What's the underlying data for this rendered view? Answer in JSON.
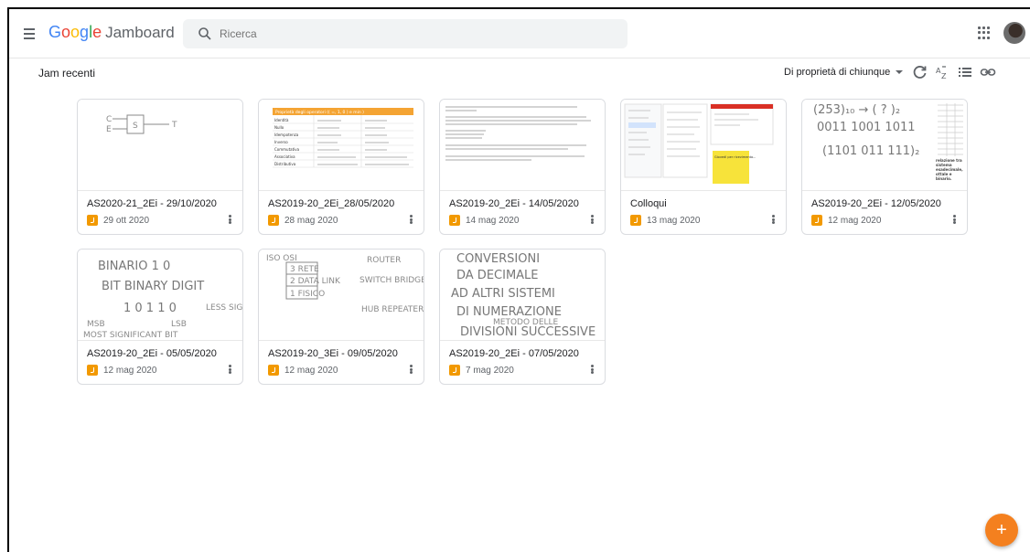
{
  "app": {
    "logo_google": "Google",
    "logo_product": "Jamboard",
    "search_placeholder": "Ricerca"
  },
  "icons": {
    "menu": "menu-icon",
    "search": "search-icon",
    "apps": "apps-grid-icon",
    "refresh": "refresh-icon",
    "sort": "sort-az-icon",
    "list": "list-view-icon",
    "link": "link-icon",
    "add": "add-icon"
  },
  "toolbar": {
    "section_title": "Jam recenti",
    "owner_filter": "Di proprietà di chiunque"
  },
  "colors": {
    "fab": "#f4801f",
    "jam_icon": "#f29900",
    "table_header": "#f4a433",
    "sticky_note": "#f7e33a"
  },
  "jams": [
    {
      "title": "AS2020-21_2Ei - 29/10/2020",
      "date": "29 ott 2020"
    },
    {
      "title": "AS2019-20_2Ei_28/05/2020",
      "date": "28 mag 2020"
    },
    {
      "title": "AS2019-20_2Ei - 14/05/2020",
      "date": "14 mag 2020"
    },
    {
      "title": "Colloqui",
      "date": "13 mag 2020"
    },
    {
      "title": "AS2019-20_2Ei - 12/05/2020",
      "date": "12 mag 2020"
    },
    {
      "title": "AS2019-20_2Ei - 05/05/2020",
      "date": "12 mag 2020"
    },
    {
      "title": "AS2019-20_3Ei - 09/05/2020",
      "date": "12 mag 2020"
    },
    {
      "title": "AS2019-20_2Ei - 07/05/2020",
      "date": "7 mag 2020"
    }
  ],
  "thumbs": {
    "t1": {
      "c": "C",
      "e": "E",
      "s": "S",
      "t": "T"
    },
    "t2": {
      "header": "Proprietà degli operatori (( =, 1, 0 ) e min )",
      "rows": [
        "Identità",
        "Nullo",
        "Idempotenza",
        "Inverso",
        "Commutativa",
        "Associativa",
        "Distributiva"
      ]
    },
    "t4": {
      "note": "Giovedì per ricevimento..."
    },
    "t5": {
      "line1": "(253)₁₀ → ( ? )₂",
      "line2": "0011 1001 1011",
      "line3": "(1101 011 111)₂",
      "side": "relazione tra sistema esadecimale, ottale e binario."
    },
    "t6": {
      "l1": "BINARIO 1 0",
      "l2": "BIT BINARY DIGIT",
      "l3": "1 0 1 1 0",
      "l4": "MSB",
      "l5": "LSB",
      "l6": "LESS SIGN BIT",
      "l7": "MOST SIGNIFICANT BIT"
    },
    "t7": {
      "l1": "ISO OSI",
      "l2": "3 RETE",
      "l3": "2 DATA LINK",
      "l4": "1 FISICO",
      "l5": "ROUTER",
      "l6": "SWITCH BRIDGE",
      "l7": "HUB REPEATER"
    },
    "t8": {
      "l1": "CONVERSIONI",
      "l2": "DA DECIMALE",
      "l3": "AD ALTRI SISTEMI",
      "l4": "DI NUMERAZIONE",
      "l5": "METODO DELLE",
      "l6": "DIVISIONI SUCCESSIVE"
    }
  }
}
